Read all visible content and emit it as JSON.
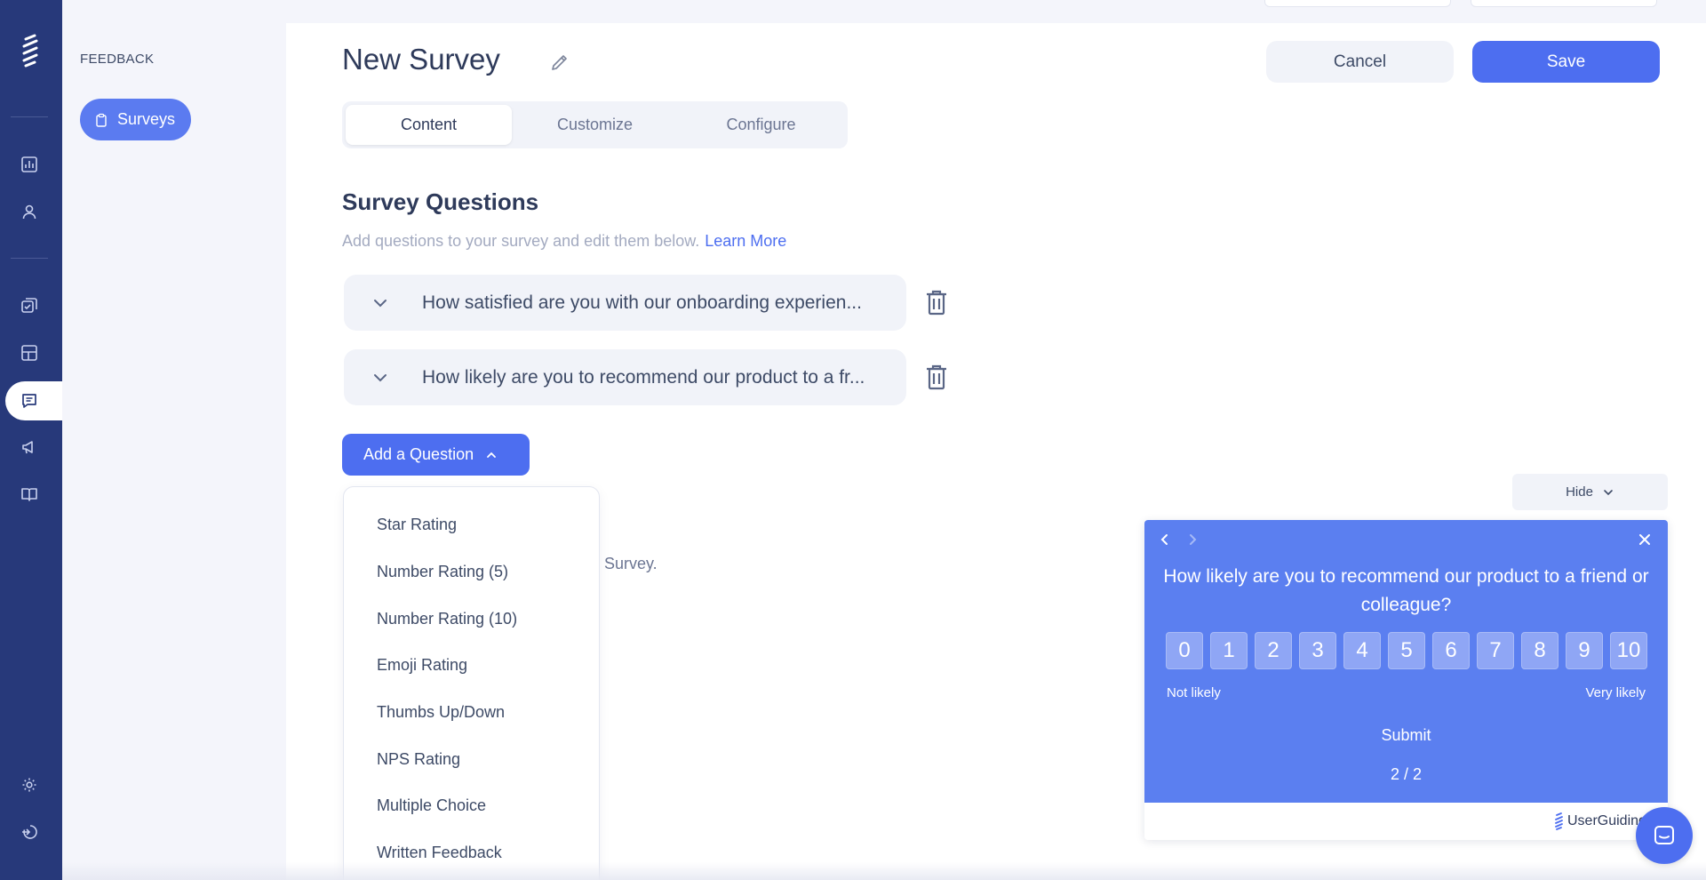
{
  "sidebar": {
    "section_label": "FEEDBACK",
    "active_item": "Surveys"
  },
  "header": {
    "title": "New Survey",
    "cancel_label": "Cancel",
    "save_label": "Save"
  },
  "tabs": [
    {
      "label": "Content",
      "active": true
    },
    {
      "label": "Customize",
      "active": false
    },
    {
      "label": "Configure",
      "active": false
    }
  ],
  "questions_section": {
    "title": "Survey Questions",
    "subtitle": "Add questions to your survey and edit them below.",
    "learn_more": "Learn More",
    "questions": [
      "How satisfied are you with our onboarding experien...",
      "How likely are you to recommend our product to a fr..."
    ],
    "add_button": "Add a Question",
    "background_text": "Survey."
  },
  "question_types": [
    "Star Rating",
    "Number Rating (5)",
    "Number Rating (10)",
    "Emoji Rating",
    "Thumbs Up/Down",
    "NPS Rating",
    "Multiple Choice",
    "Written Feedback"
  ],
  "preview": {
    "hide_label": "Hide",
    "question": "How likely are you to recommend our product to a friend or colleague?",
    "scale": [
      "0",
      "1",
      "2",
      "3",
      "4",
      "5",
      "6",
      "7",
      "8",
      "9",
      "10"
    ],
    "low_label": "Not likely",
    "high_label": "Very likely",
    "submit_label": "Submit",
    "page_indicator": "2 / 2",
    "brand": "UserGuiding",
    "accent_color": "#5b7ff0"
  },
  "colors": {
    "rail": "#27397a",
    "primary": "#4d6ef0",
    "sidebar_bg": "#f4f5fb"
  }
}
